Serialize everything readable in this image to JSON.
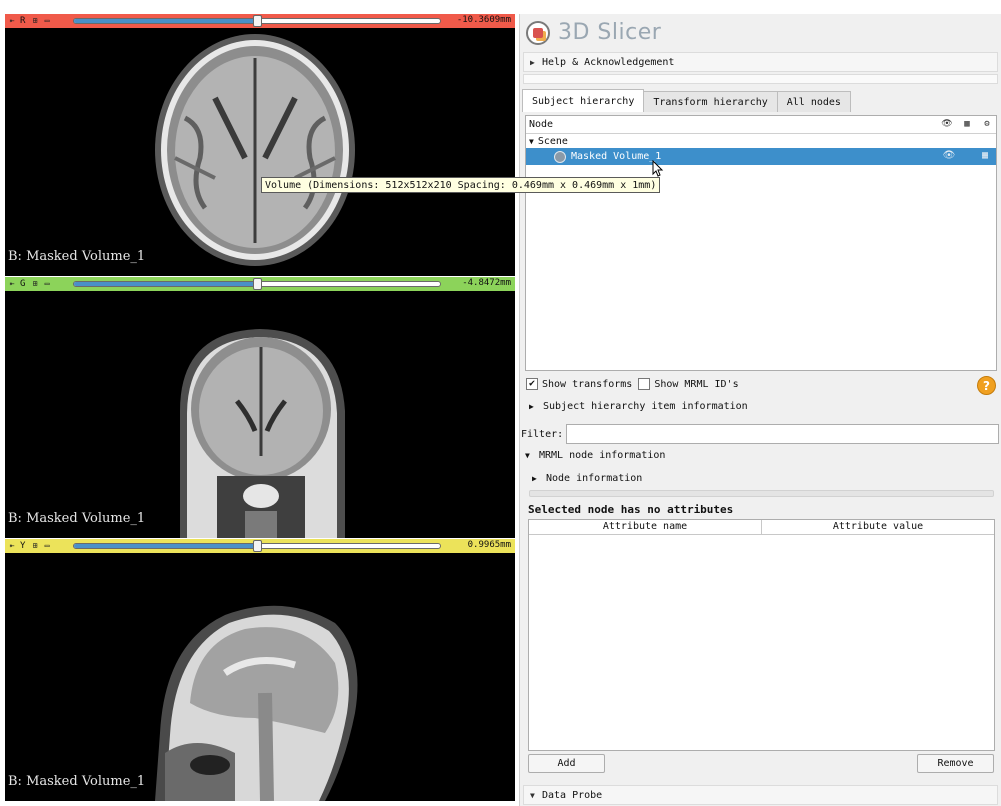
{
  "viewers": [
    {
      "id": "red",
      "letter": "R",
      "offset": "-10.3609mm",
      "label": "B: Masked Volume_1",
      "bar_color": "#f05a4a",
      "slider_fraction": 0.5
    },
    {
      "id": "green",
      "letter": "G",
      "offset": "-4.8472mm",
      "label": "B: Masked Volume_1",
      "bar_color": "#8cd35a",
      "slider_fraction": 0.5
    },
    {
      "id": "yellow",
      "letter": "Y",
      "offset": "0.9965mm",
      "label": "B: Masked Volume_1",
      "bar_color": "#ece35a",
      "slider_fraction": 0.5
    }
  ],
  "app": {
    "name": "3D Slicer"
  },
  "sections": {
    "help": "Help & Acknowledgement",
    "item_info": "Subject hierarchy item information",
    "mrml_info": "MRML node information",
    "node_info": "Node information",
    "data_probe": "Data Probe"
  },
  "tabs": [
    "Subject hierarchy",
    "Transform hierarchy",
    "All nodes"
  ],
  "tree": {
    "column_header": "Node",
    "scene_label": "Scene",
    "selected_node": "Masked Volume_1"
  },
  "tooltip": "Volume (Dimensions: 512x512x210  Spacing: 0.469mm x 0.469mm x 1mm)",
  "options": {
    "show_transforms": "Show transforms",
    "show_transforms_checked": true,
    "show_ids": "Show MRML ID's",
    "show_ids_checked": false
  },
  "filter": {
    "label": "Filter:",
    "value": ""
  },
  "attributes": {
    "empty_message": "Selected node has no attributes",
    "col_name": "Attribute name",
    "col_value": "Attribute value",
    "add_label": "Add",
    "remove_label": "Remove"
  },
  "icons": {
    "help": "help-icon",
    "app_logo": "slicer-logo-icon"
  }
}
